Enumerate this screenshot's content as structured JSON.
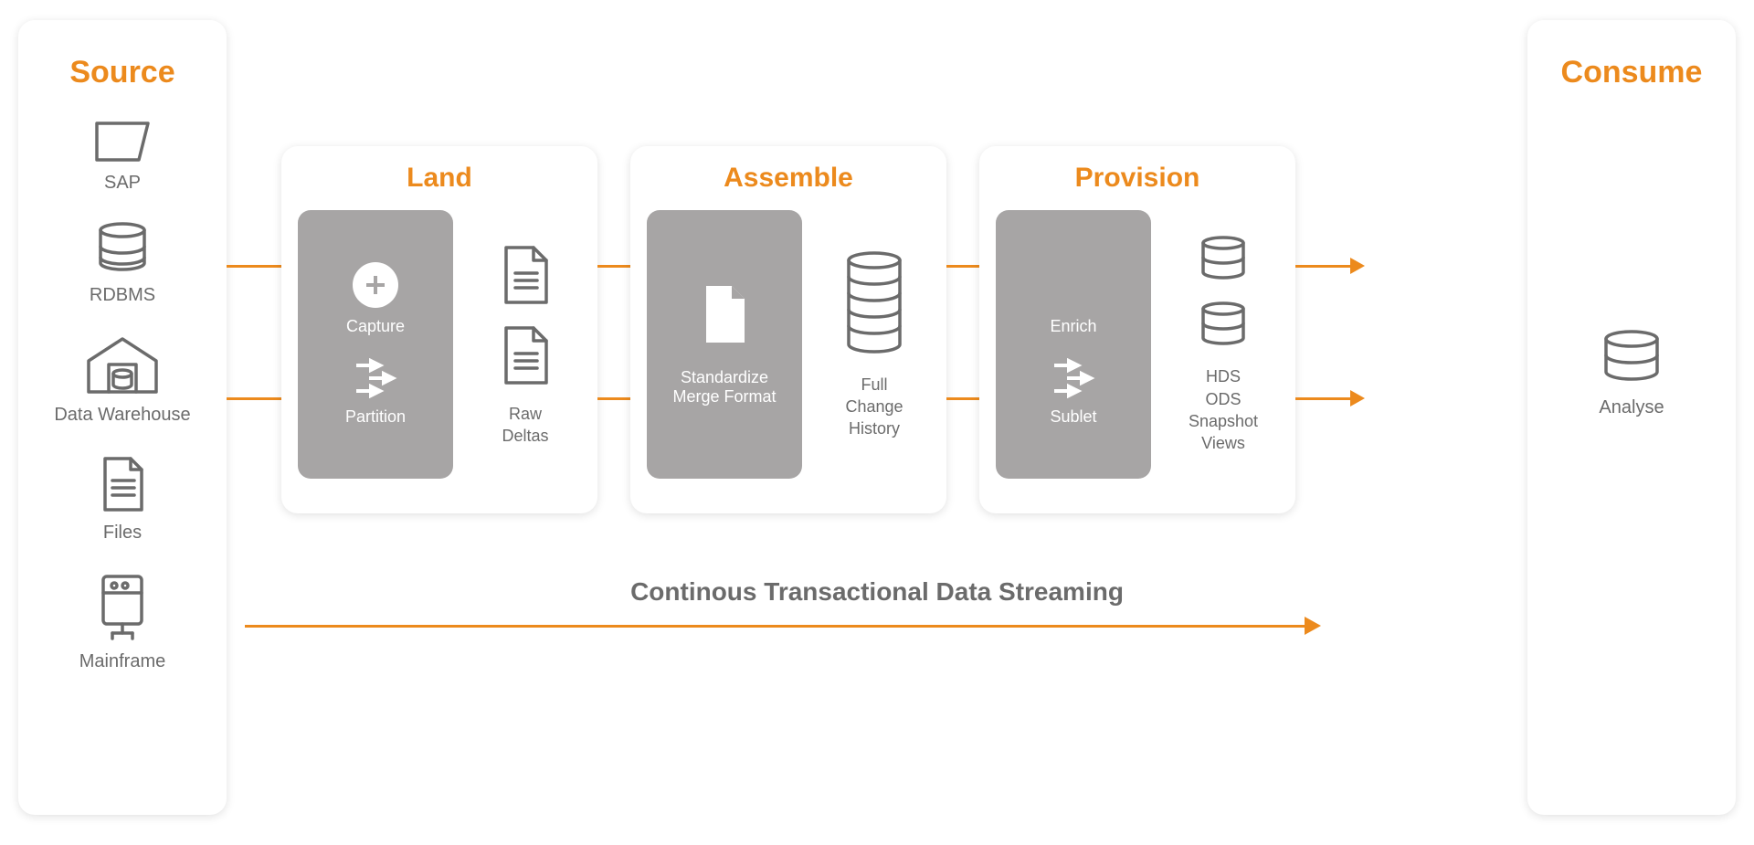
{
  "source": {
    "title": "Source",
    "items": [
      {
        "label": "SAP",
        "icon": "sap-icon"
      },
      {
        "label": "RDBMS",
        "icon": "database-icon"
      },
      {
        "label": "Data Warehouse",
        "icon": "warehouse-icon"
      },
      {
        "label": "Files",
        "icon": "file-icon"
      },
      {
        "label": "Mainframe",
        "icon": "mainframe-icon"
      }
    ]
  },
  "stages": {
    "land": {
      "title": "Land",
      "gray": {
        "top": "Capture",
        "bottom": "Partition"
      },
      "right_label": "Raw\nDeltas"
    },
    "assemble": {
      "title": "Assemble",
      "gray_text": "Standardize\nMerge Format",
      "right_label": "Full\nChange\nHistory"
    },
    "provision": {
      "title": "Provision",
      "gray": {
        "top": "Enrich",
        "bottom": "Sublet"
      },
      "right_label": "HDS\nODS\nSnapshot\nViews"
    }
  },
  "consume": {
    "title": "Consume",
    "label": "Analyse"
  },
  "bottom_label": "Continous Transactional Data Streaming",
  "colors": {
    "accent": "#ec8a1d",
    "gray": "#a7a5a5",
    "label": "#6b6b6b"
  }
}
